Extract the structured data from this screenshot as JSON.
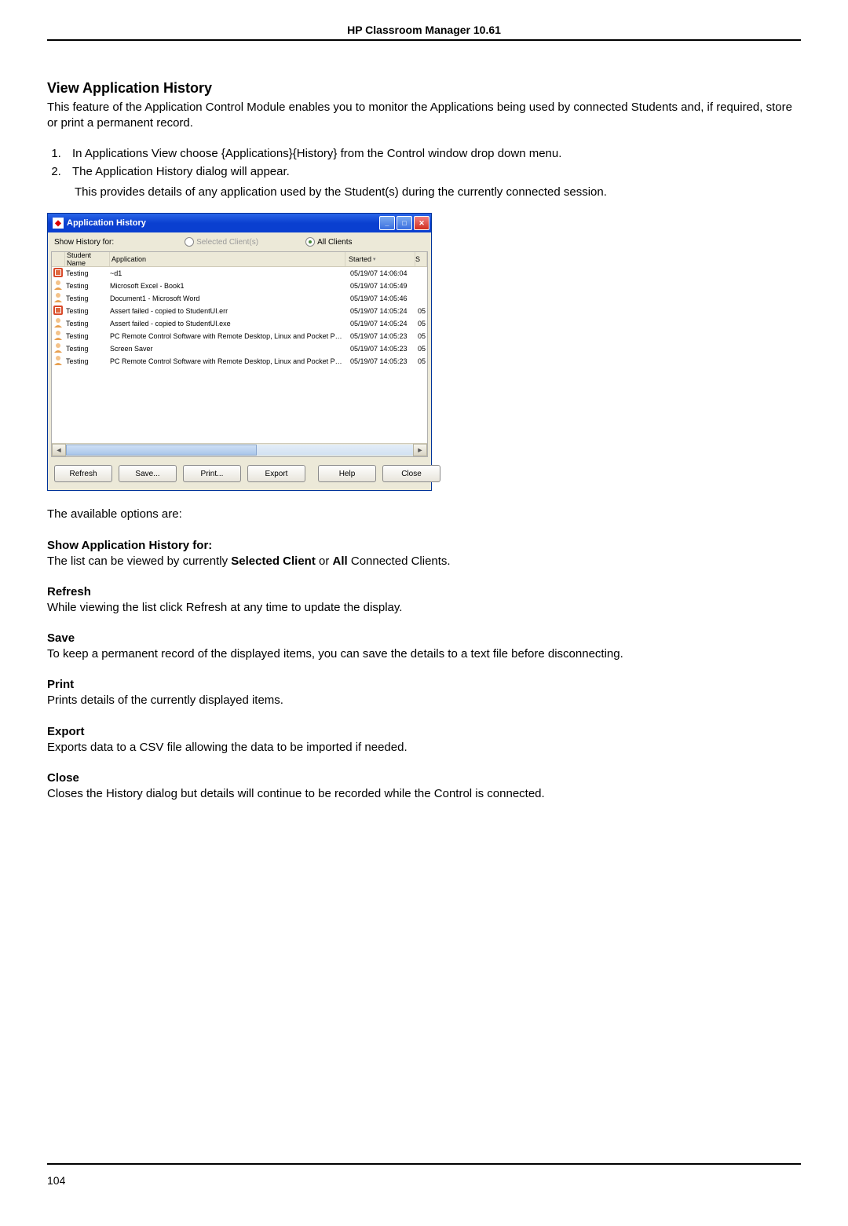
{
  "header": {
    "product_title": "HP Classroom Manager 10.61"
  },
  "section": {
    "title": "View Application History",
    "intro": "This feature of the Application Control Module enables you to monitor the Applications being used by connected Students and, if required, store or print a permanent record.",
    "steps": [
      "In Applications View choose {Applications}{History} from the Control window drop down menu.",
      "The Application History dialog will appear."
    ],
    "step_sub": "This provides details of any application used by the Student(s) during the currently connected session."
  },
  "dialog": {
    "title": "Application History",
    "show_label": "Show History for:",
    "radio_selected_label": "Selected Client(s)",
    "radio_all_label": "All Clients",
    "columns": {
      "name": "Student Name",
      "app": "Application",
      "started": "Started",
      "s": "S"
    },
    "rows": [
      {
        "icon": "red",
        "name": "Testing",
        "app": "~d1",
        "started": "05/19/07 14:06:04",
        "s": ""
      },
      {
        "icon": "user",
        "name": "Testing",
        "app": "Microsoft Excel - Book1",
        "started": "05/19/07 14:05:49",
        "s": ""
      },
      {
        "icon": "user",
        "name": "Testing",
        "app": "Document1 - Microsoft Word",
        "started": "05/19/07 14:05:46",
        "s": ""
      },
      {
        "icon": "red",
        "name": "Testing",
        "app": "Assert failed - copied to StudentUI.err",
        "started": "05/19/07 14:05:24",
        "s": "05"
      },
      {
        "icon": "user",
        "name": "Testing",
        "app": "Assert failed - copied to StudentUI.exe",
        "started": "05/19/07 14:05:24",
        "s": "05"
      },
      {
        "icon": "user",
        "name": "Testing",
        "app": "PC Remote Control Software with Remote Desktop, Linux and Pocket PC support. - Microsoft Internet Explorer",
        "started": "05/19/07 14:05:23",
        "s": "05"
      },
      {
        "icon": "user",
        "name": "Testing",
        "app": "Screen Saver",
        "started": "05/19/07 14:05:23",
        "s": "05"
      },
      {
        "icon": "user",
        "name": "Testing",
        "app": "PC Remote Control Software with Remote Desktop, Linux and Pocket PC support. - Microsoft Internet Explorer",
        "started": "05/19/07 14:05:23",
        "s": "05"
      }
    ],
    "buttons": {
      "refresh": "Refresh",
      "save": "Save...",
      "print": "Print...",
      "export": "Export",
      "help": "Help",
      "close": "Close"
    }
  },
  "options_intro": "The available options are:",
  "options": {
    "show_for": {
      "title": "Show Application History for:",
      "body_pre": "The list can be viewed by currently ",
      "body_bold1": "Selected Client",
      "body_mid": " or ",
      "body_bold2": "All",
      "body_post": " Connected Clients."
    },
    "refresh": {
      "title": "Refresh",
      "body": "While viewing the list click Refresh at any time to update the display."
    },
    "save": {
      "title": "Save",
      "body": "To keep a permanent record of the displayed items, you can save the details to a text file before disconnecting."
    },
    "print": {
      "title": "Print",
      "body": "Prints details of the currently displayed items."
    },
    "export": {
      "title": "Export",
      "body": "Exports data to a CSV file allowing the data to be imported if needed."
    },
    "close": {
      "title": "Close",
      "body": "Closes the History dialog but details will continue to be recorded while the Control is connected."
    }
  },
  "footer": {
    "page_number": "104"
  }
}
